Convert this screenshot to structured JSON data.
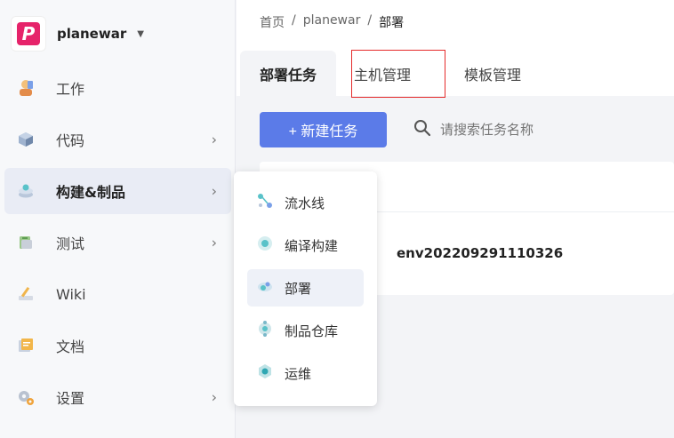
{
  "project": {
    "name": "planewar"
  },
  "sidebar": {
    "items": [
      {
        "label": "工作",
        "icon": "work-icon",
        "has_submenu": false
      },
      {
        "label": "代码",
        "icon": "code-icon",
        "has_submenu": true
      },
      {
        "label": "构建&制品",
        "icon": "build-icon",
        "has_submenu": true
      },
      {
        "label": "测试",
        "icon": "test-icon",
        "has_submenu": true
      },
      {
        "label": "Wiki",
        "icon": "wiki-icon",
        "has_submenu": false
      },
      {
        "label": "文档",
        "icon": "docs-icon",
        "has_submenu": false
      },
      {
        "label": "设置",
        "icon": "settings-icon",
        "has_submenu": true
      }
    ],
    "active": "构建&制品"
  },
  "breadcrumb": {
    "home": "首页",
    "sep": "/",
    "project": "planewar",
    "current": "部署"
  },
  "tabs": [
    {
      "label": "部署任务"
    },
    {
      "label": "主机管理"
    },
    {
      "label": "模板管理"
    }
  ],
  "toolbar": {
    "new_task_label": "+ 新建任务",
    "search_placeholder": "请搜索任务名称"
  },
  "task_list": {
    "rows": [
      {
        "name": "env20220929111032​6"
      }
    ]
  },
  "flyout": {
    "items": [
      {
        "label": "流水线"
      },
      {
        "label": "编译构建"
      },
      {
        "label": "部署"
      },
      {
        "label": "制品仓库"
      },
      {
        "label": "运维"
      }
    ],
    "active": "部署"
  },
  "colors": {
    "primary": "#5b7be8",
    "highlight": "#e52b2b",
    "brand": "#e6236a"
  }
}
